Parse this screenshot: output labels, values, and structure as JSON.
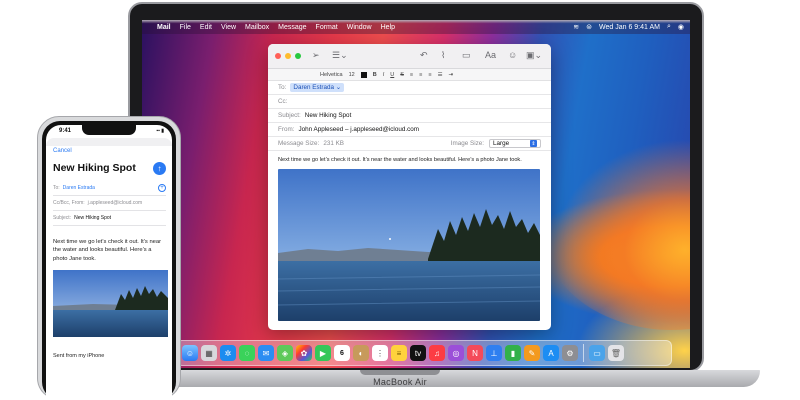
{
  "mac": {
    "menubar": {
      "app": "Mail",
      "items": [
        "File",
        "Edit",
        "View",
        "Mailbox",
        "Message",
        "Format",
        "Window",
        "Help"
      ],
      "clock": "Wed Jan 6  9:41 AM"
    },
    "brand": "MacBook Air",
    "compose": {
      "format": {
        "font": "Helvetica",
        "size": "12",
        "bold": "B",
        "italic": "I",
        "underline": "U",
        "strike": "S"
      },
      "to_label": "To:",
      "to_value": "Daren Estrada ⌄",
      "cc_label": "Cc:",
      "subject_label": "Subject:",
      "subject_value": "New Hiking Spot",
      "from_label": "From:",
      "from_value": "John Appleseed – j.appleseed@icloud.com",
      "msg_size_label": "Message Size:",
      "msg_size_value": "231 KB",
      "image_size_label": "Image Size:",
      "image_size_value": "Large",
      "body": "Next time we go let’s check it out. It’s near the water and looks beautiful. Here’s a photo Jane took."
    },
    "dock": {
      "calendar_day": "6"
    }
  },
  "iphone": {
    "time": "9:41",
    "cancel": "Cancel",
    "subject": "New Hiking Spot",
    "to_label": "To:",
    "to_value": "Daren Estrada",
    "ccbcc_label": "Cc/Bcc, From:",
    "ccbcc_value": "j.appleseed@icloud.com",
    "subject_label": "Subject:",
    "subject_value": "New Hiking Spot",
    "body": "Next time we go let’s check it out. It’s near the water and looks beautiful. Here’s a photo Jane took.",
    "signature": "Sent from my iPhone"
  }
}
